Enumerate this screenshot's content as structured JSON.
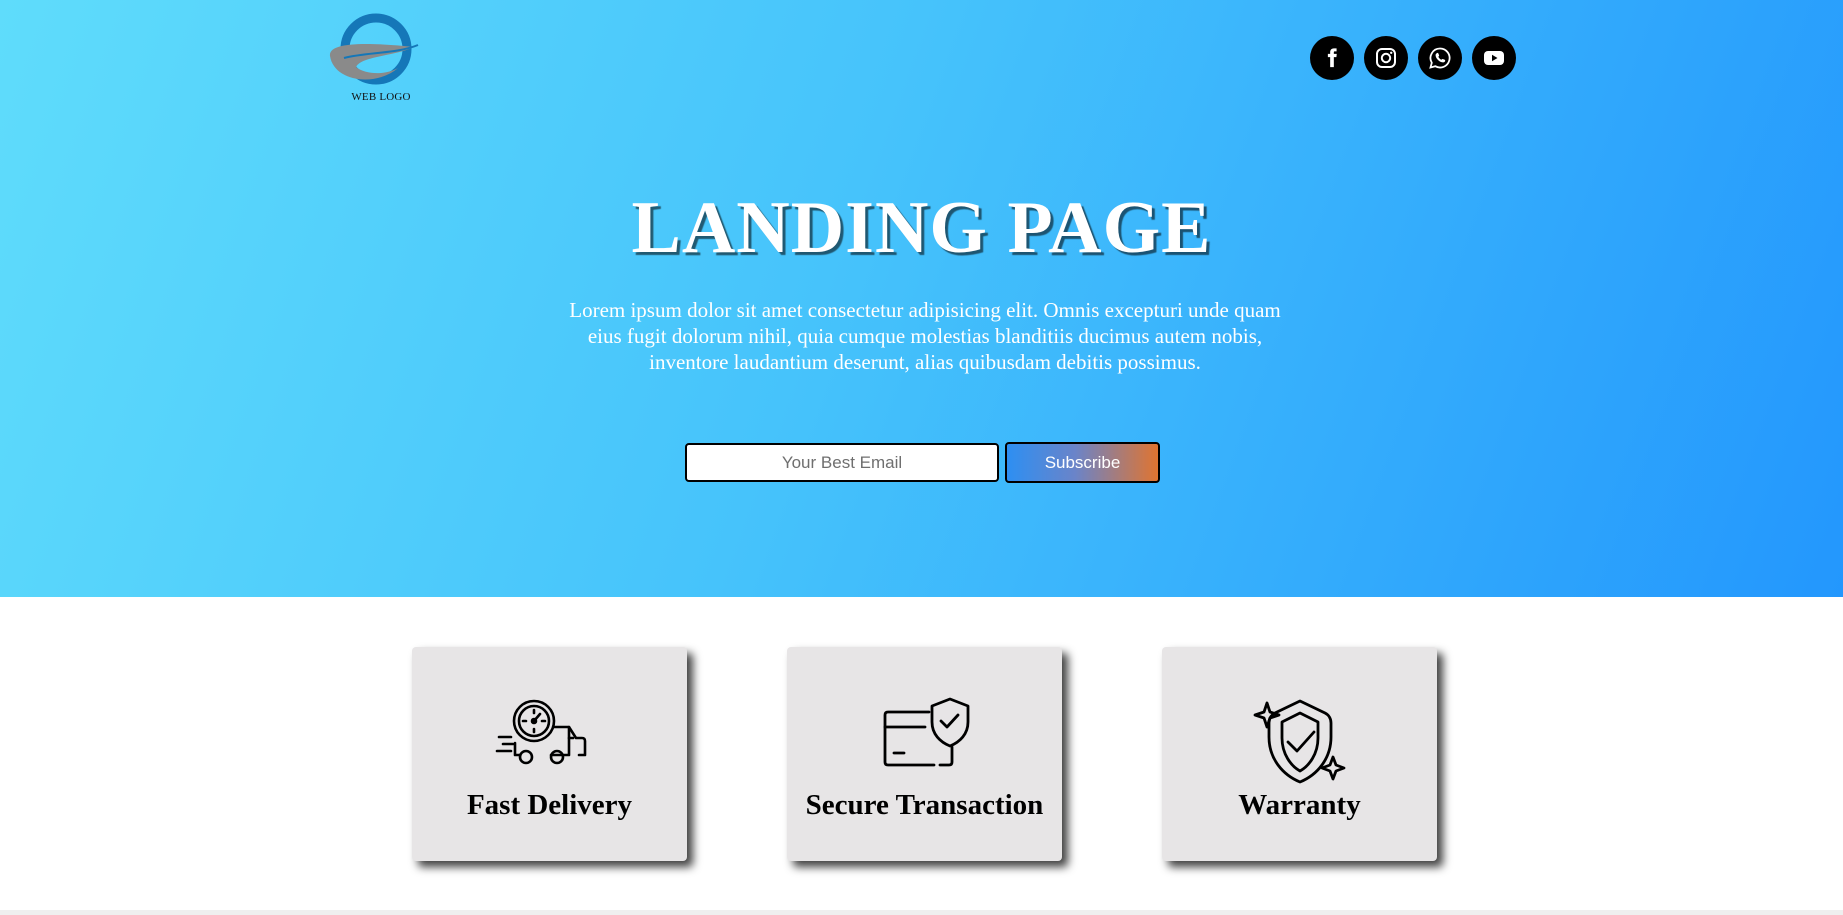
{
  "header": {
    "logo_text": "WEB LOGO",
    "socials": [
      {
        "icon": "facebook-icon"
      },
      {
        "icon": "instagram-icon"
      },
      {
        "icon": "whatsapp-icon"
      },
      {
        "icon": "youtube-icon"
      }
    ]
  },
  "hero": {
    "title": "LANDING PAGE",
    "text": "Lorem ipsum dolor sit amet consectetur adipisicing elit. Omnis excepturi unde quam eius fugit dolorum nihil, quia cumque molestias blanditiis ducimus autem nobis, inventore laudantium deserunt, alias quibusdam debitis possimus.",
    "email_placeholder": "Your Best Email",
    "subscribe_label": "Subscribe"
  },
  "features": [
    {
      "title": "Fast Delivery",
      "icon": "delivery-truck-icon"
    },
    {
      "title": "Secure Transaction",
      "icon": "secure-card-icon"
    },
    {
      "title": "Warranty",
      "icon": "warranty-shield-icon"
    }
  ],
  "colors": {
    "hero_gradient_start": "#5fdcfb",
    "hero_gradient_end": "#2397fd",
    "card_background": "#e7e5e6",
    "subscribe_gradient_start": "#2d8ff2",
    "subscribe_gradient_end": "#e07430"
  }
}
